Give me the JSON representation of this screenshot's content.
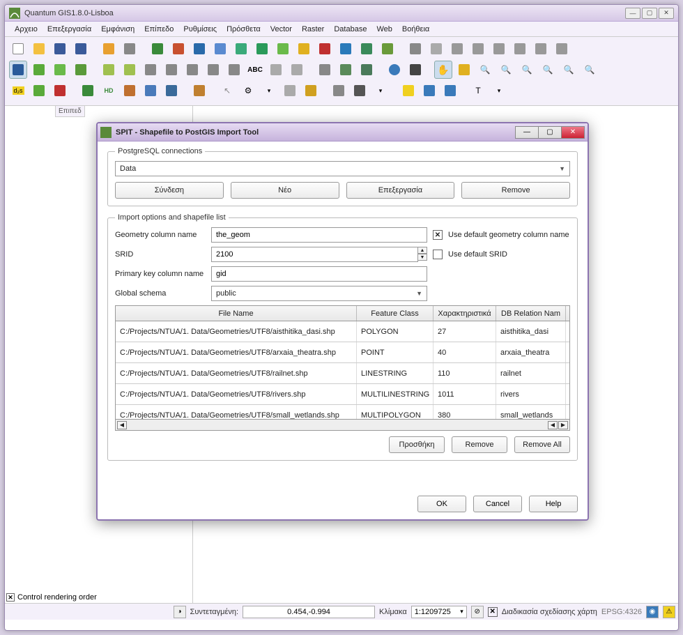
{
  "main_window": {
    "title": "Quantum GIS1.8.0-Lisboa"
  },
  "menu": [
    "Αρχειο",
    "Επεξεργασία",
    "Εμφάνιση",
    "Επίπεδο",
    "Ρυθμίσεις",
    "Πρόσθετα",
    "Vector",
    "Raster",
    "Database",
    "Web",
    "Βοήθεια"
  ],
  "left_panel": {
    "tab_label": "Επιπεδ",
    "render_order_label": "Control rendering order"
  },
  "status": {
    "coord_label": "Συντεταγμένη:",
    "coord_value": "0.454,-0.994",
    "scale_label": "Κλίμακα",
    "scale_value": "1:1209725",
    "render_label": "Διαδικασία σχεδίασης χάρτη",
    "epsg": "EPSG:4326"
  },
  "dialog": {
    "title": "SPIT - Shapefile to PostGIS Import Tool",
    "pg_group": "PostgreSQL connections",
    "pg_connection": "Data",
    "btn_connect": "Σύνδεση",
    "btn_new": "Νέο",
    "btn_edit": "Επεξεργασία",
    "btn_remove": "Remove",
    "import_group": "Import options and shapefile list",
    "lbl_geom": "Geometry column name",
    "geom_value": "the_geom",
    "chk_geom_label": "Use default geometry column name",
    "lbl_srid": "SRID",
    "srid_value": "2100",
    "chk_srid_label": "Use default SRID",
    "lbl_pk": "Primary key column name",
    "pk_value": "gid",
    "lbl_schema": "Global schema",
    "schema_value": "public",
    "table": {
      "headers": [
        "File Name",
        "Feature Class",
        "Χαρακτηριστικά",
        "DB Relation Nam"
      ],
      "rows": [
        {
          "file": "C:/Projects/NTUA/1. Data/Geometries/UTF8/aisthitika_dasi.shp",
          "fclass": "POLYGON",
          "feat": "27",
          "rel": "aisthitika_dasi"
        },
        {
          "file": "C:/Projects/NTUA/1. Data/Geometries/UTF8/arxaia_theatra.shp",
          "fclass": "POINT",
          "feat": "40",
          "rel": "arxaia_theatra"
        },
        {
          "file": "C:/Projects/NTUA/1. Data/Geometries/UTF8/railnet.shp",
          "fclass": "LINESTRING",
          "feat": "110",
          "rel": "railnet"
        },
        {
          "file": "C:/Projects/NTUA/1. Data/Geometries/UTF8/rivers.shp",
          "fclass": "MULTILINESTRING",
          "feat": "1011",
          "rel": "rivers"
        },
        {
          "file": "C:/Projects/NTUA/1. Data/Geometries/UTF8/small_wetlands.shp",
          "fclass": "MULTIPOLYGON",
          "feat": "380",
          "rel": "small_wetlands"
        }
      ]
    },
    "btn_add": "Προσθήκη",
    "btn_tbl_remove": "Remove",
    "btn_remove_all": "Remove All",
    "btn_ok": "OK",
    "btn_cancel": "Cancel",
    "btn_help": "Help"
  }
}
